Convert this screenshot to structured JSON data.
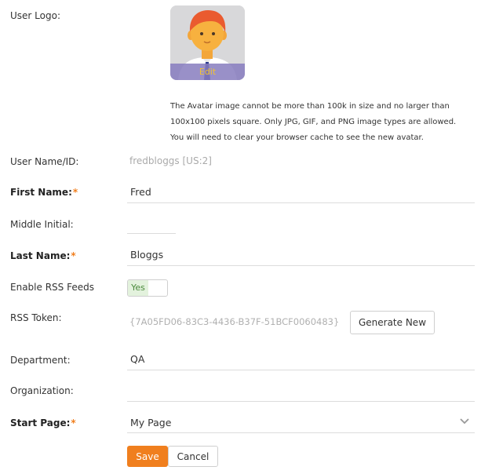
{
  "user_logo": {
    "label": "User Logo:",
    "edit_label": "Edit",
    "help_lines": [
      "The Avatar image cannot be more than 100k in size and no larger than",
      "100x100 pixels square. Only JPG, GIF, and PNG image types are allowed.",
      "You will need to clear your browser cache to see the new avatar."
    ]
  },
  "user_name": {
    "label": "User Name/ID:",
    "value": "fredbloggs [US:2]"
  },
  "first_name": {
    "label": "First Name:",
    "required": "*",
    "value": "Fred"
  },
  "middle_initial": {
    "label": "Middle Initial:",
    "value": ""
  },
  "last_name": {
    "label": "Last Name:",
    "required": "*",
    "value": "Bloggs"
  },
  "rss_feeds": {
    "label": "Enable RSS Feeds",
    "toggle_label": "Yes",
    "enabled": true
  },
  "rss_token": {
    "label": "RSS Token:",
    "value": "{7A05FD06-83C3-4436-B37F-51BCF0060483}",
    "generate_label": "Generate New"
  },
  "department": {
    "label": "Department:",
    "value": "QA"
  },
  "organization": {
    "label": "Organization:",
    "value": ""
  },
  "start_page": {
    "label": "Start Page:",
    "required": "*",
    "value": "My Page"
  },
  "actions": {
    "save_label": "Save",
    "cancel_label": "Cancel"
  },
  "colors": {
    "accent": "#f07f1e",
    "toggle_on": "#e3f2dd",
    "edit_overlay": "#877dbe"
  },
  "icons": {
    "chevron": "chevron-down-icon"
  }
}
